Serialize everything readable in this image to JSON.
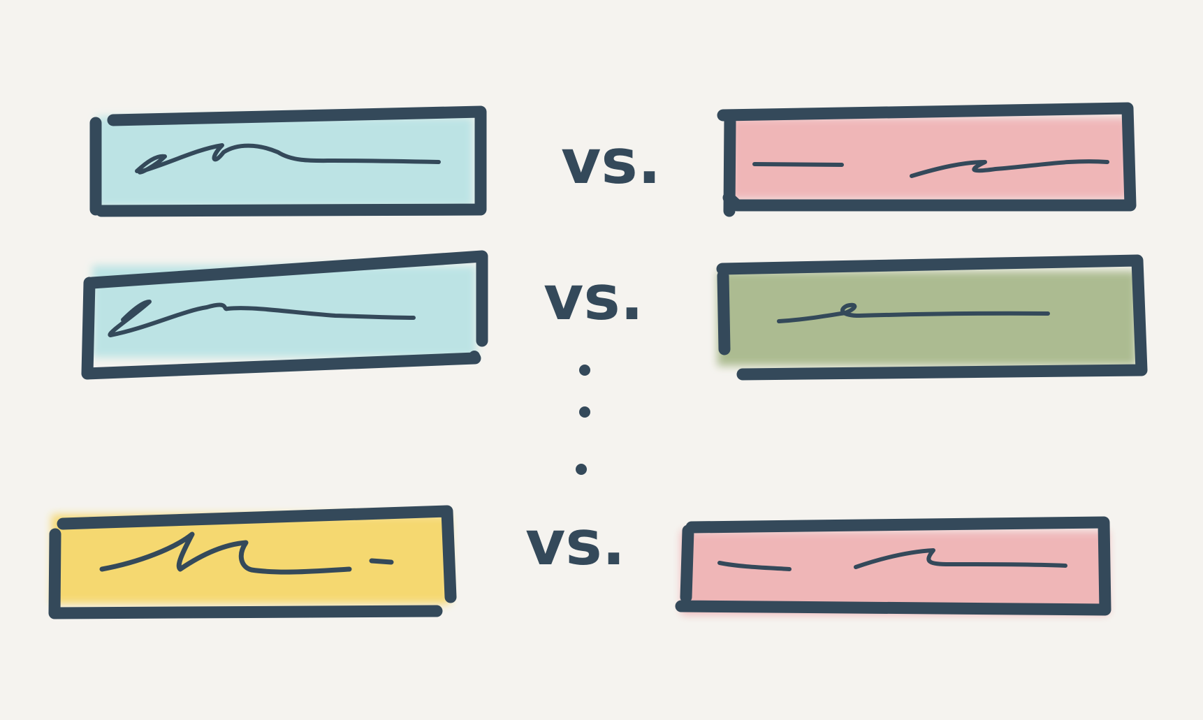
{
  "comparison_label": "vs.",
  "colors": {
    "background": "#f5f3ef",
    "ink": "#34495a",
    "blue_fill": "#b9e3e4",
    "red_fill": "#efb3b5",
    "green_fill": "#a9b98c",
    "yellow_fill": "#f5d76a"
  },
  "rows": [
    {
      "left_color": "blue_fill",
      "right_color": "red_fill"
    },
    {
      "left_color": "blue_fill",
      "right_color": "green_fill"
    },
    {
      "left_color": "yellow_fill",
      "right_color": "red_fill"
    }
  ]
}
